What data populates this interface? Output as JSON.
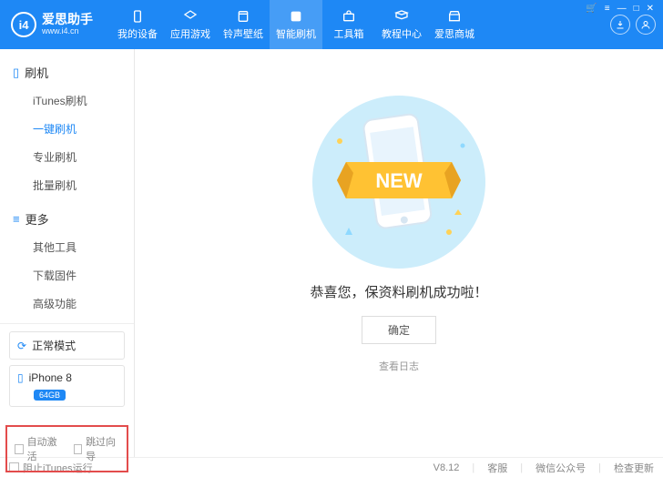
{
  "header": {
    "logo_badge": "i4",
    "logo_cn": "爱思助手",
    "logo_url": "www.i4.cn",
    "nav": [
      {
        "label": "我的设备"
      },
      {
        "label": "应用游戏"
      },
      {
        "label": "铃声壁纸"
      },
      {
        "label": "智能刷机"
      },
      {
        "label": "工具箱"
      },
      {
        "label": "教程中心"
      },
      {
        "label": "爱思商城"
      }
    ]
  },
  "sidebar": {
    "group1": {
      "title": "刷机",
      "items": [
        "iTunes刷机",
        "一键刷机",
        "专业刷机",
        "批量刷机"
      ]
    },
    "group2": {
      "title": "更多",
      "items": [
        "其他工具",
        "下载固件",
        "高级功能"
      ]
    },
    "mode": "正常模式",
    "device": "iPhone 8",
    "storage": "64GB",
    "check1": "自动激活",
    "check2": "跳过向导"
  },
  "main": {
    "new_label": "NEW",
    "message": "恭喜您，保资料刷机成功啦！",
    "ok": "确定",
    "log": "查看日志"
  },
  "status": {
    "stop_itunes": "阻止iTunes运行",
    "version": "V8.12",
    "cs": "客服",
    "wechat": "微信公众号",
    "update": "检查更新"
  }
}
